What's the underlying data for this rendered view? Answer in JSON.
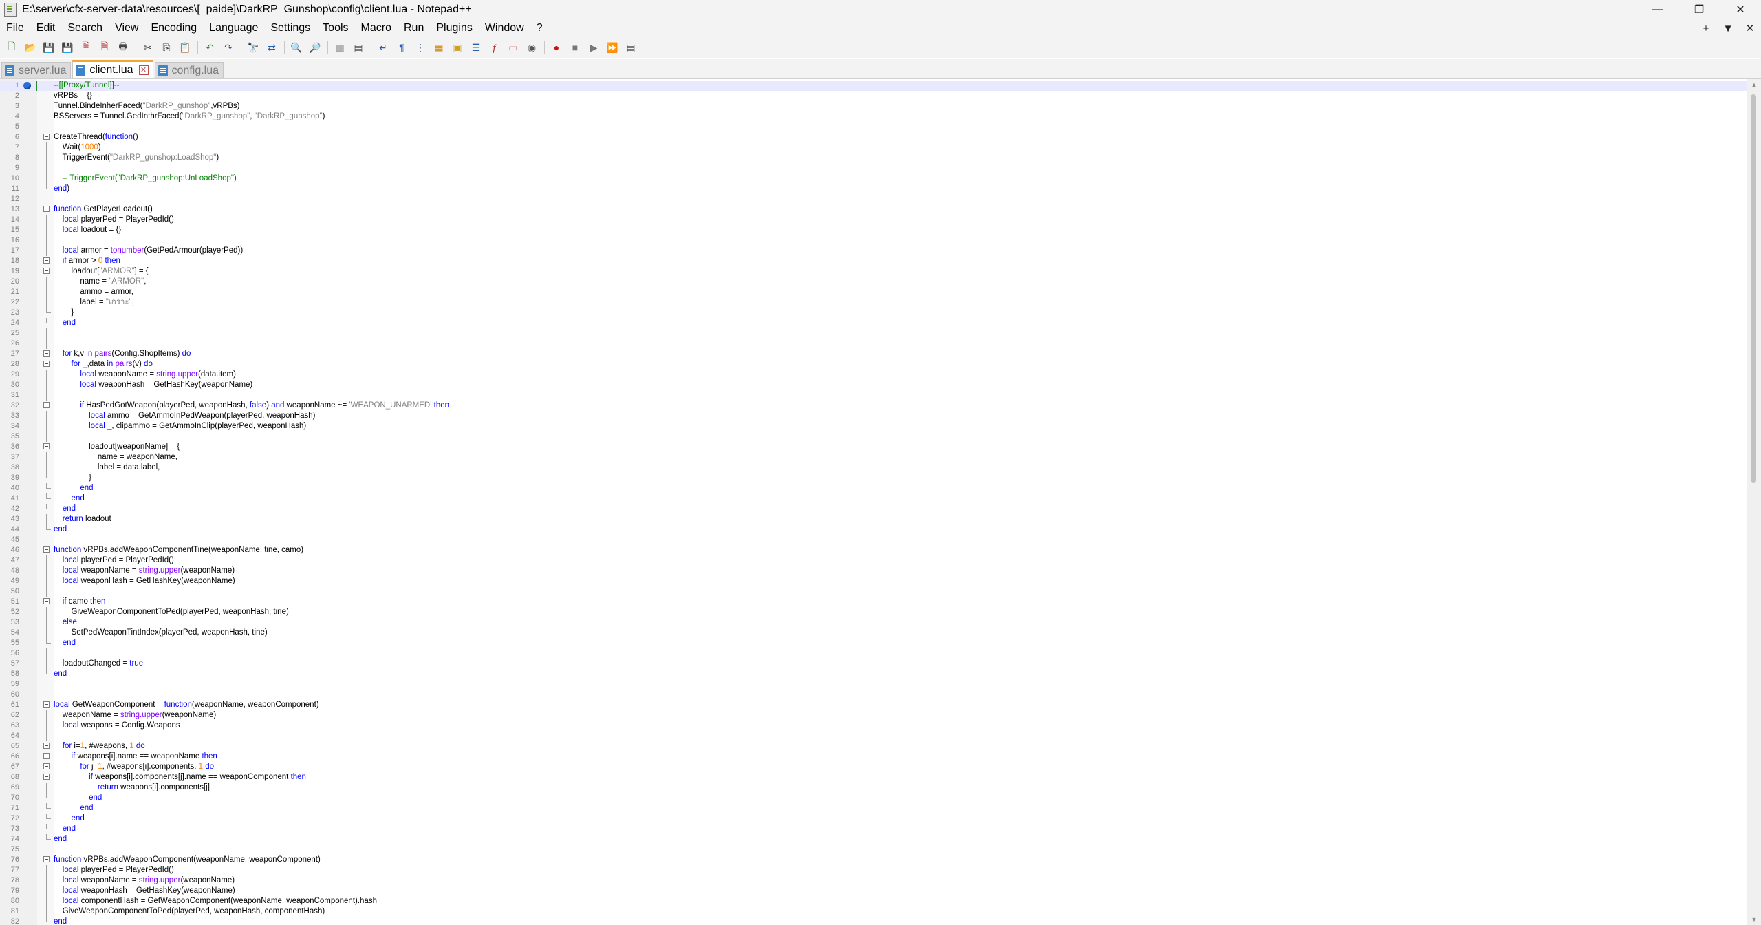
{
  "window": {
    "title": "E:\\server\\cfx-server-data\\resources\\[_paide]\\DarkRP_Gunshop\\config\\client.lua - Notepad++",
    "controls": [
      "—",
      "❐",
      "✕"
    ]
  },
  "menu": {
    "items": [
      "File",
      "Edit",
      "Search",
      "View",
      "Encoding",
      "Language",
      "Settings",
      "Tools",
      "Macro",
      "Run",
      "Plugins",
      "Window",
      "?"
    ],
    "right": [
      "+",
      "▼",
      "✕"
    ]
  },
  "toolbar": {
    "icons": [
      {
        "name": "new-file-icon",
        "glyph": "🗋",
        "color": "#3a7a3a"
      },
      {
        "name": "open-file-icon",
        "glyph": "📂",
        "color": "#c8902a"
      },
      {
        "name": "save-icon",
        "glyph": "💾",
        "color": "#2b5fa8"
      },
      {
        "name": "save-all-icon",
        "glyph": "💾",
        "color": "#2b5fa8"
      },
      {
        "name": "close-icon",
        "glyph": "🗎",
        "color": "#b03030"
      },
      {
        "name": "close-all-icon",
        "glyph": "🗎",
        "color": "#b03030"
      },
      {
        "name": "print-icon",
        "glyph": "🖶",
        "color": "#444444"
      },
      {
        "sep": true
      },
      {
        "name": "cut-icon",
        "glyph": "✂",
        "color": "#444444"
      },
      {
        "name": "copy-icon",
        "glyph": "⎘",
        "color": "#444444"
      },
      {
        "name": "paste-icon",
        "glyph": "📋",
        "color": "#8a6a2a"
      },
      {
        "sep": true
      },
      {
        "name": "undo-icon",
        "glyph": "↶",
        "color": "#2a7a2a"
      },
      {
        "name": "redo-icon",
        "glyph": "↷",
        "color": "#2a4a9a"
      },
      {
        "sep": true
      },
      {
        "name": "find-icon",
        "glyph": "🔭",
        "color": "#333333"
      },
      {
        "name": "replace-icon",
        "glyph": "⇄",
        "color": "#2a5fb0"
      },
      {
        "sep": true
      },
      {
        "name": "zoom-in-icon",
        "glyph": "🔍",
        "color": "#2a5fb0"
      },
      {
        "name": "zoom-out-icon",
        "glyph": "🔎",
        "color": "#2a5fb0"
      },
      {
        "sep": true
      },
      {
        "name": "sync-vertical-icon",
        "glyph": "▥",
        "color": "#555555"
      },
      {
        "name": "sync-horizontal-icon",
        "glyph": "▤",
        "color": "#555555"
      },
      {
        "sep": true
      },
      {
        "name": "word-wrap-icon",
        "glyph": "↵",
        "color": "#2a5fb0"
      },
      {
        "name": "show-all-chars-icon",
        "glyph": "¶",
        "color": "#2a5fb0"
      },
      {
        "name": "indent-guide-icon",
        "glyph": "⋮",
        "color": "#2a5fb0"
      },
      {
        "name": "udl-icon",
        "glyph": "▦",
        "color": "#d08a1a"
      },
      {
        "name": "doc-map-icon",
        "glyph": "▣",
        "color": "#d0a020"
      },
      {
        "name": "doc-list-icon",
        "glyph": "☰",
        "color": "#2a5fb0"
      },
      {
        "name": "function-list-icon",
        "glyph": "ƒ",
        "color": "#b03030"
      },
      {
        "name": "folder-workspace-icon",
        "glyph": "▭",
        "color": "#c83a3a"
      },
      {
        "name": "monitor-icon",
        "glyph": "◉",
        "color": "#555555"
      },
      {
        "sep": true
      },
      {
        "name": "record-macro-icon",
        "glyph": "●",
        "color": "#d01010"
      },
      {
        "name": "stop-macro-icon",
        "glyph": "■",
        "color": "#777777"
      },
      {
        "name": "play-macro-icon",
        "glyph": "▶",
        "color": "#777777"
      },
      {
        "name": "run-macro-multiple-icon",
        "glyph": "⏩",
        "color": "#2a5fb0"
      },
      {
        "name": "save-macro-icon",
        "glyph": "▤",
        "color": "#555555"
      }
    ]
  },
  "tabs": [
    {
      "label": "server.lua",
      "active": false
    },
    {
      "label": "client.lua",
      "active": true
    },
    {
      "label": "config.lua",
      "active": false
    }
  ],
  "editor": {
    "current_line": 1,
    "lines": [
      [
        [
          "cm",
          "--[[Proxy/Tunnel]]--"
        ]
      ],
      [
        [
          "",
          "vRPBs = {}"
        ]
      ],
      [
        [
          "",
          "Tunnel.BindeInherFaced("
        ],
        [
          "str",
          "\"DarkRP_gunshop\""
        ],
        [
          "",
          ",vRPBs)"
        ]
      ],
      [
        [
          "",
          "BSServers = Tunnel.GedInthrFaced("
        ],
        [
          "str",
          "\"DarkRP_gunshop\""
        ],
        [
          "",
          ", "
        ],
        [
          "str",
          "\"DarkRP_gunshop\""
        ],
        [
          "",
          ")"
        ]
      ],
      [],
      [
        [
          "",
          "CreateThread("
        ],
        [
          "kw",
          "function"
        ],
        [
          "",
          "()"
        ]
      ],
      [
        [
          "",
          "    Wait("
        ],
        [
          "num",
          "1000"
        ],
        [
          "",
          ")"
        ]
      ],
      [
        [
          "",
          "    TriggerEvent("
        ],
        [
          "str",
          "\"DarkRP_gunshop:LoadShop\""
        ],
        [
          "",
          ")"
        ]
      ],
      [],
      [
        [
          "cm",
          "    -- TriggerEvent(\"DarkRP_gunshop:UnLoadShop\")"
        ]
      ],
      [
        [
          "kw",
          "end"
        ],
        [
          "",
          ")"
        ]
      ],
      [],
      [
        [
          "kw",
          "function"
        ],
        [
          "",
          " GetPlayerLoadout()"
        ]
      ],
      [
        [
          "kw",
          "    local"
        ],
        [
          "",
          " playerPed = PlayerPedId()"
        ]
      ],
      [
        [
          "kw",
          "    local"
        ],
        [
          "",
          " loadout = {}"
        ]
      ],
      [],
      [
        [
          "kw",
          "    local"
        ],
        [
          "",
          " armor = "
        ],
        [
          "fn",
          "tonumber"
        ],
        [
          "",
          "(GetPedArmour(playerPed))"
        ]
      ],
      [
        [
          "kw",
          "    if"
        ],
        [
          "",
          " armor > "
        ],
        [
          "num",
          "0"
        ],
        [
          "kw",
          " then"
        ]
      ],
      [
        [
          "",
          "        loadout["
        ],
        [
          "str",
          "\"ARMOR\""
        ],
        [
          "",
          "] = {"
        ]
      ],
      [
        [
          "",
          "            name = "
        ],
        [
          "str",
          "\"ARMOR\""
        ],
        [
          "",
          ","
        ]
      ],
      [
        [
          "",
          "            ammo = armor,"
        ]
      ],
      [
        [
          "",
          "            label = "
        ],
        [
          "str",
          "\"เกราะ\""
        ],
        [
          "",
          ","
        ]
      ],
      [
        [
          "",
          "        }"
        ]
      ],
      [
        [
          "kw",
          "    end"
        ]
      ],
      [],
      [],
      [
        [
          "kw",
          "    for"
        ],
        [
          "",
          " k,v "
        ],
        [
          "kw",
          "in"
        ],
        [
          "fn",
          " pairs"
        ],
        [
          "",
          "(Config.ShopItems) "
        ],
        [
          "kw",
          "do"
        ]
      ],
      [
        [
          "kw",
          "        for"
        ],
        [
          "",
          " _,data "
        ],
        [
          "kw",
          "in"
        ],
        [
          "fn",
          " pairs"
        ],
        [
          "",
          "(v) "
        ],
        [
          "kw",
          "do"
        ]
      ],
      [
        [
          "kw",
          "            local"
        ],
        [
          "",
          " weaponName = "
        ],
        [
          "fn",
          "string.upper"
        ],
        [
          "",
          "(data.item)"
        ]
      ],
      [
        [
          "kw",
          "            local"
        ],
        [
          "",
          " weaponHash = GetHashKey(weaponName)"
        ]
      ],
      [],
      [
        [
          "kw",
          "            if"
        ],
        [
          "",
          " HasPedGotWeapon(playerPed, weaponHash, "
        ],
        [
          "kw",
          "false"
        ],
        [
          "",
          ") "
        ],
        [
          "kw",
          "and"
        ],
        [
          "",
          " weaponName ~= "
        ],
        [
          "str",
          "'WEAPON_UNARMED'"
        ],
        [
          "kw",
          " then"
        ]
      ],
      [
        [
          "kw",
          "                local"
        ],
        [
          "",
          " ammo = GetAmmoInPedWeapon(playerPed, weaponHash)"
        ]
      ],
      [
        [
          "kw",
          "                local"
        ],
        [
          "",
          " _, clipammo = GetAmmoInClip(playerPed, weaponHash)"
        ]
      ],
      [],
      [
        [
          "",
          "                loadout[weaponName] = {"
        ]
      ],
      [
        [
          "",
          "                    name = weaponName,"
        ]
      ],
      [
        [
          "",
          "                    label = data.label,"
        ]
      ],
      [
        [
          "",
          "                }"
        ]
      ],
      [
        [
          "kw",
          "            end"
        ]
      ],
      [
        [
          "kw",
          "        end"
        ]
      ],
      [
        [
          "kw",
          "    end"
        ]
      ],
      [
        [
          "kw",
          "    return"
        ],
        [
          "",
          " loadout"
        ]
      ],
      [
        [
          "kw",
          "end"
        ]
      ],
      [],
      [
        [
          "kw",
          "function"
        ],
        [
          "",
          " vRPBs.addWeaponComponentTine(weaponName, tine, camo)"
        ]
      ],
      [
        [
          "kw",
          "    local"
        ],
        [
          "",
          " playerPed = PlayerPedId()"
        ]
      ],
      [
        [
          "kw",
          "    local"
        ],
        [
          "",
          " weaponName = "
        ],
        [
          "fn",
          "string.upper"
        ],
        [
          "",
          "(weaponName)"
        ]
      ],
      [
        [
          "kw",
          "    local"
        ],
        [
          "",
          " weaponHash = GetHashKey(weaponName)"
        ]
      ],
      [],
      [
        [
          "kw",
          "    if"
        ],
        [
          "",
          " camo "
        ],
        [
          "kw",
          "then"
        ]
      ],
      [
        [
          "",
          "        GiveWeaponComponentToPed(playerPed, weaponHash, tine)"
        ]
      ],
      [
        [
          "kw",
          "    else"
        ]
      ],
      [
        [
          "",
          "        SetPedWeaponTintIndex(playerPed, weaponHash, tine)"
        ]
      ],
      [
        [
          "kw",
          "    end"
        ]
      ],
      [],
      [
        [
          "",
          "    loadoutChanged = "
        ],
        [
          "kw",
          "true"
        ]
      ],
      [
        [
          "kw",
          "end"
        ]
      ],
      [],
      [],
      [
        [
          "kw",
          "local"
        ],
        [
          "",
          " GetWeaponComponent = "
        ],
        [
          "kw",
          "function"
        ],
        [
          "",
          "(weaponName, weaponComponent)"
        ]
      ],
      [
        [
          "",
          "    weaponName = "
        ],
        [
          "fn",
          "string.upper"
        ],
        [
          "",
          "(weaponName)"
        ]
      ],
      [
        [
          "kw",
          "    local"
        ],
        [
          "",
          " weapons = Config.Weapons"
        ]
      ],
      [],
      [
        [
          "kw",
          "    for"
        ],
        [
          "",
          " i="
        ],
        [
          "num",
          "1"
        ],
        [
          "",
          ", #weapons, "
        ],
        [
          "num",
          "1"
        ],
        [
          "kw",
          " do"
        ]
      ],
      [
        [
          "kw",
          "        if"
        ],
        [
          "",
          " weapons[i].name == weaponName "
        ],
        [
          "kw",
          "then"
        ]
      ],
      [
        [
          "kw",
          "            for"
        ],
        [
          "",
          " j="
        ],
        [
          "num",
          "1"
        ],
        [
          "",
          ", #weapons[i].components, "
        ],
        [
          "num",
          "1"
        ],
        [
          "kw",
          " do"
        ]
      ],
      [
        [
          "kw",
          "                if"
        ],
        [
          "",
          " weapons[i].components[j].name == weaponComponent "
        ],
        [
          "kw",
          "then"
        ]
      ],
      [
        [
          "kw",
          "                    return"
        ],
        [
          "",
          " weapons[i].components[j]"
        ]
      ],
      [
        [
          "kw",
          "                end"
        ]
      ],
      [
        [
          "kw",
          "            end"
        ]
      ],
      [
        [
          "kw",
          "        end"
        ]
      ],
      [
        [
          "kw",
          "    end"
        ]
      ],
      [
        [
          "kw",
          "end"
        ]
      ],
      [],
      [
        [
          "kw",
          "function"
        ],
        [
          "",
          " vRPBs.addWeaponComponent(weaponName, weaponComponent)"
        ]
      ],
      [
        [
          "kw",
          "    local"
        ],
        [
          "",
          " playerPed = PlayerPedId()"
        ]
      ],
      [
        [
          "kw",
          "    local"
        ],
        [
          "",
          " weaponName = "
        ],
        [
          "fn",
          "string.upper"
        ],
        [
          "",
          "(weaponName)"
        ]
      ],
      [
        [
          "kw",
          "    local"
        ],
        [
          "",
          " weaponHash = GetHashKey(weaponName)"
        ]
      ],
      [
        [
          "kw",
          "    local"
        ],
        [
          "",
          " componentHash = GetWeaponComponent(weaponName, weaponComponent).hash"
        ]
      ],
      [
        [
          "",
          "    GiveWeaponComponentToPed(playerPed, weaponHash, componentHash)"
        ]
      ],
      [
        [
          "kw",
          "end"
        ]
      ]
    ]
  }
}
